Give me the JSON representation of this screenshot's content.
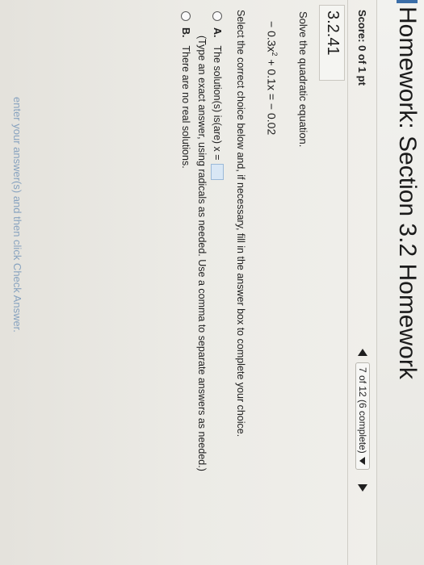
{
  "header": {
    "title": "Homework: Section 3.2 Homework"
  },
  "score": {
    "label": "Score: 0 of 1 pt"
  },
  "navigation": {
    "progress": "7 of 12 (6 complete)"
  },
  "question": {
    "number": "3.2.41",
    "instruction": "Solve the quadratic equation.",
    "equation_left": "− 0.3x",
    "equation_exponent": "2",
    "equation_right": " + 0.1x = − 0.02",
    "select_instruction": "Select the correct choice below and, if necessary, fill in the answer box to complete your choice."
  },
  "choices": [
    {
      "letter": "A.",
      "text": "The solution(s) is(are) x =",
      "note": "(Type an exact answer, using radicals as needed. Use a comma to separate answers as needed.)"
    },
    {
      "letter": "B.",
      "text": "There are no real solutions."
    }
  ],
  "footer": {
    "hint": "enter your answer(s) and then click Check Answer."
  },
  "colors": {
    "accent": "#3b6ea8",
    "answer_box": "#d9e7f5"
  }
}
